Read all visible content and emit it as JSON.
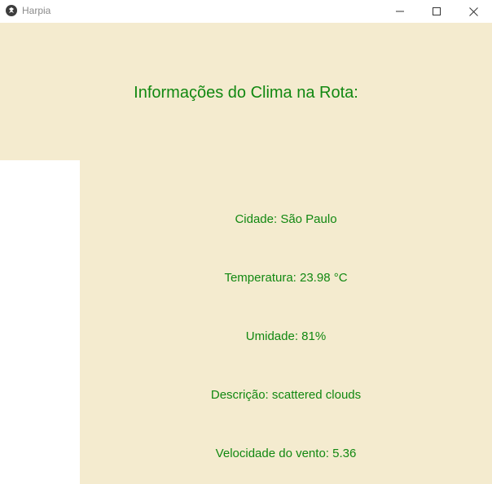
{
  "window": {
    "title": "Harpia"
  },
  "header": {
    "title": "Informações do Clima na Rota:"
  },
  "weather": {
    "city": "Cidade: São Paulo",
    "temperature": "Temperatura: 23.98 °C",
    "humidity": "Umidade: 81%",
    "description": "Descrição: scattered clouds",
    "wind_speed": "Velocidade do vento: 5.36"
  },
  "colors": {
    "panel_background": "#f4ebcf",
    "text_green": "#118811"
  },
  "icons": {
    "app": "kivy-app-icon",
    "minimize": "minimize-icon",
    "maximize": "maximize-icon",
    "close": "close-icon"
  }
}
